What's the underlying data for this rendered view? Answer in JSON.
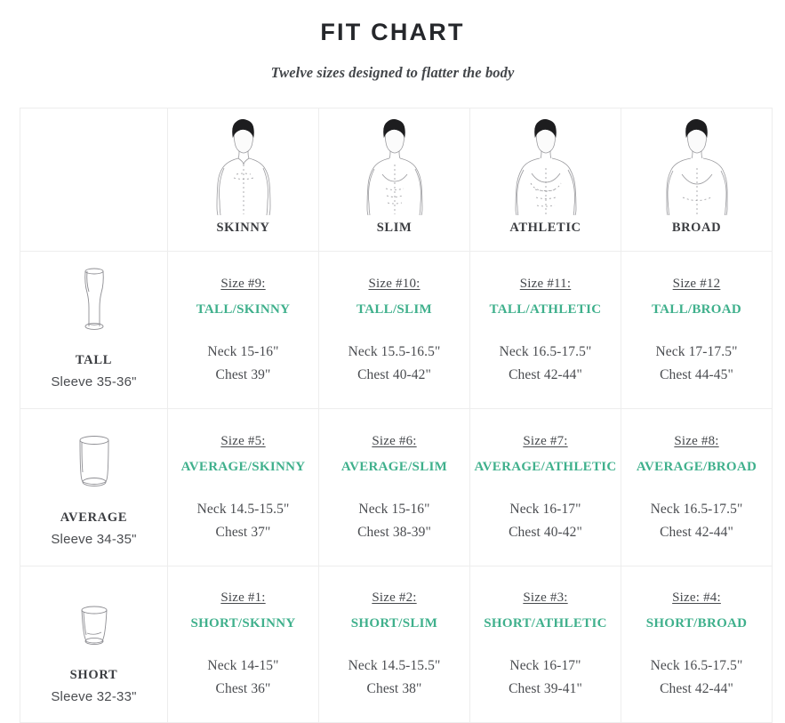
{
  "header": {
    "title": "FIT CHART",
    "subtitle": "Twelve sizes designed to flatter the body"
  },
  "accent_color": "#3fb08c",
  "border_color": "#ededed",
  "text_color": "#4a4c50",
  "body_types": [
    {
      "label": "SKINNY",
      "icon": "male-torso-skinny-icon"
    },
    {
      "label": "SLIM",
      "icon": "male-torso-slim-icon"
    },
    {
      "label": "ATHLETIC",
      "icon": "male-torso-athletic-icon"
    },
    {
      "label": "BROAD",
      "icon": "male-torso-broad-icon"
    }
  ],
  "heights": [
    {
      "label": "TALL",
      "sleeve": "Sleeve 35-36\"",
      "icon": "tall-glass-icon"
    },
    {
      "label": "AVERAGE",
      "sleeve": "Sleeve 34-35\"",
      "icon": "average-glass-icon"
    },
    {
      "label": "SHORT",
      "sleeve": "Sleeve 32-33\"",
      "icon": "short-glass-icon"
    }
  ],
  "rows": [
    {
      "height": "TALL",
      "cells": [
        {
          "size_num": "Size #9:",
          "size_name": "TALL/SKINNY",
          "neck": "Neck 15-16\"",
          "chest": "Chest 39\""
        },
        {
          "size_num": "Size #10:",
          "size_name": "TALL/SLIM",
          "neck": "Neck 15.5-16.5\"",
          "chest": "Chest 40-42\""
        },
        {
          "size_num": "Size #11:",
          "size_name": "TALL/ATHLETIC",
          "neck": "Neck 16.5-17.5\"",
          "chest": "Chest 42-44\""
        },
        {
          "size_num": "Size #12",
          "size_name": "TALL/BROAD",
          "neck": "Neck 17-17.5\"",
          "chest": "Chest 44-45\""
        }
      ]
    },
    {
      "height": "AVERAGE",
      "cells": [
        {
          "size_num": "Size #5:",
          "size_name": "AVERAGE/SKINNY",
          "neck": "Neck 14.5-15.5\"",
          "chest": "Chest 37\""
        },
        {
          "size_num": "Size #6:",
          "size_name": "AVERAGE/SLIM",
          "neck": "Neck 15-16\"",
          "chest": "Chest 38-39\""
        },
        {
          "size_num": "Size #7:",
          "size_name": "AVERAGE/ATHLETIC",
          "neck": "Neck 16-17\"",
          "chest": "Chest 40-42\""
        },
        {
          "size_num": "Size #8:",
          "size_name": "AVERAGE/BROAD",
          "neck": "Neck 16.5-17.5\"",
          "chest": "Chest 42-44\""
        }
      ]
    },
    {
      "height": "SHORT",
      "cells": [
        {
          "size_num": "Size #1:",
          "size_name": "SHORT/SKINNY",
          "neck": "Neck 14-15\"",
          "chest": "Chest 36\""
        },
        {
          "size_num": "Size #2:",
          "size_name": "SHORT/SLIM",
          "neck": "Neck 14.5-15.5\"",
          "chest": "Chest 38\""
        },
        {
          "size_num": "Size #3:",
          "size_name": "SHORT/ATHLETIC",
          "neck": "Neck 16-17\"",
          "chest": "Chest 39-41\""
        },
        {
          "size_num": "Size: #4:",
          "size_name": "SHORT/BROAD",
          "neck": "Neck 16.5-17.5\"",
          "chest": "Chest 42-44\""
        }
      ]
    }
  ]
}
